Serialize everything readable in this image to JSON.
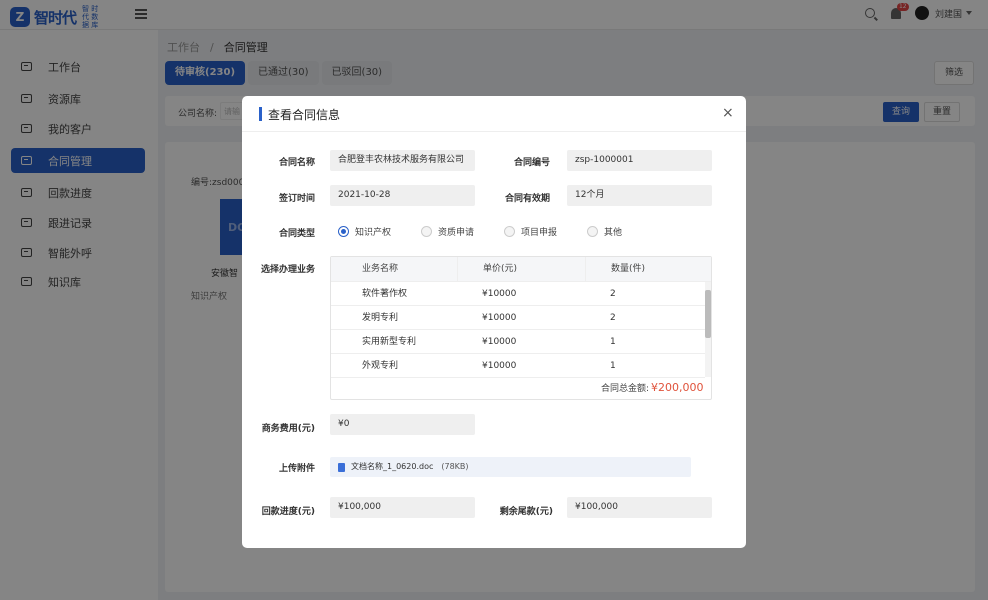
{
  "header": {
    "logo_text": "智时代",
    "logo_sub": "智 时 代 数 据 库",
    "badge_count": "12",
    "username": "刘建国"
  },
  "sidebar": {
    "items": [
      {
        "label": "工作台"
      },
      {
        "label": "资源库"
      },
      {
        "label": "我的客户"
      },
      {
        "label": "合同管理"
      },
      {
        "label": "回款进度"
      },
      {
        "label": "跟进记录"
      },
      {
        "label": "智能外呼"
      },
      {
        "label": "知识库"
      }
    ],
    "active_index": 3
  },
  "breadcrumb": {
    "root": "工作台",
    "sep": "/",
    "current": "合同管理"
  },
  "tabs": [
    {
      "label": "待审核(230)"
    },
    {
      "label": "已通过(30)"
    },
    {
      "label": "已驳回(30)"
    }
  ],
  "toolbar": {
    "filter_label": "筛选"
  },
  "filter": {
    "company_label": "公司名称:",
    "company_placeholder": "请输",
    "query_label": "查询",
    "reset_label": "重置"
  },
  "card": {
    "number_frag": "编号:zsd0000",
    "doc_frag": "DO",
    "company_frag": "安徽智",
    "tag_frag": "知识产权"
  },
  "modal": {
    "title": "查看合同信息",
    "close": "×",
    "contract_name_label": "合同名称",
    "contract_name": "合肥登丰农林技术服务有限公司",
    "contract_no_label": "合同编号",
    "contract_no": "zsp-1000001",
    "sign_time_label": "签订时间",
    "sign_time": "2021-10-28",
    "validity_label": "合同有效期",
    "validity": "12个月",
    "type_label": "合同类型",
    "types": [
      {
        "label": "知识产权",
        "checked": true
      },
      {
        "label": "资质申请",
        "checked": false
      },
      {
        "label": "项目申报",
        "checked": false
      },
      {
        "label": "其他",
        "checked": false
      }
    ],
    "business_label": "选择办理业务",
    "table": {
      "headers": [
        "业务名称",
        "单价(元)",
        "数量(件)"
      ],
      "rows": [
        [
          "软件著作权",
          "¥10000",
          "2"
        ],
        [
          "发明专利",
          "¥10000",
          "2"
        ],
        [
          "实用新型专利",
          "¥10000",
          "1"
        ],
        [
          "外观专利",
          "¥10000",
          "1"
        ]
      ],
      "total_label": "合同总金额:",
      "total_value": "¥200,000"
    },
    "biz_fee_label": "商务费用(元)",
    "biz_fee": "¥0",
    "attach_label": "上传附件",
    "attach_name": "文档名称_1_0620.doc",
    "attach_size": "(78KB)",
    "progress_label": "回款进度(元)",
    "progress": "¥100,000",
    "remain_label": "剩余尾款(元)",
    "remain": "¥100,000"
  }
}
